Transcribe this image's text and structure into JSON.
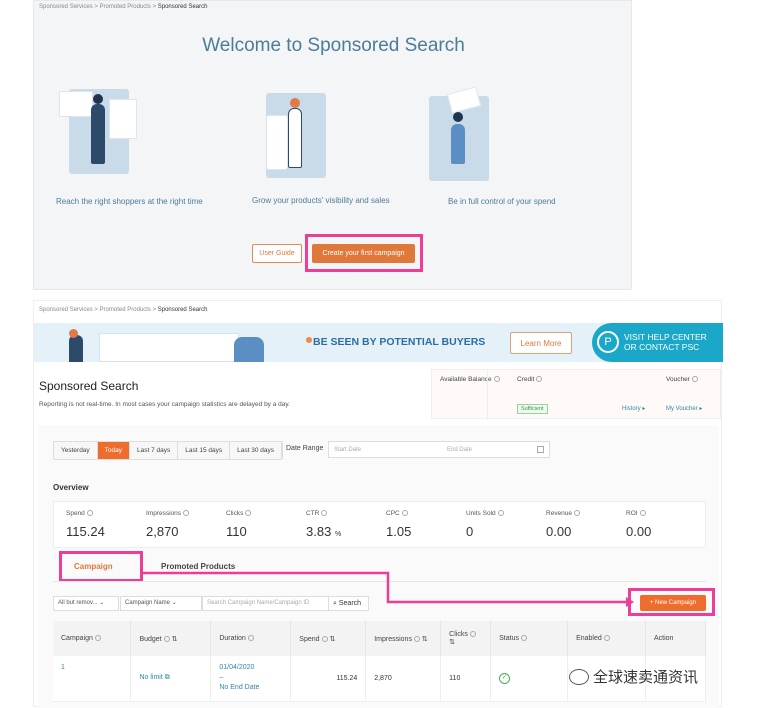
{
  "welcome": {
    "breadcrumb": [
      "Sponsored Services",
      "Promoted Products",
      "Sponsored Search"
    ],
    "title": "Welcome to Sponsored Search",
    "features": [
      "Reach the right shoppers at the right time",
      "Grow your products' visibility and sales",
      "Be in full control of your spend"
    ],
    "user_guide": "User Guide",
    "create_first": "Create your first campaign"
  },
  "page": {
    "breadcrumb": [
      "Sponsored Services",
      "Promoted Products",
      "Sponsored Search"
    ],
    "banner": {
      "headline": "BE SEEN BY POTENTIAL BUYERS",
      "learn_more": "Learn More",
      "help_line1": "VISIT HELP CENTER",
      "help_line2": "OR CONTACT PSC",
      "help_icon": "P"
    },
    "title": "Sponsored Search",
    "subtitle": "Reporting is not real-time. In most cases your campaign statistics are delayed by a day.",
    "balance": {
      "available": "Available Balance",
      "credit": "Credit",
      "voucher": "Voucher",
      "sufficient": "Sufficient",
      "history": "History ▸",
      "my_voucher": "My Voucher ▸"
    },
    "date_buttons": [
      "Yesterday",
      "Today",
      "Last 7 days",
      "Last 15 days",
      "Last 30 days"
    ],
    "date_active": "Today",
    "date_range": {
      "label": "Date Range",
      "start": "Start Date",
      "end": "End Date"
    },
    "overview": {
      "title": "Overview",
      "stats": [
        {
          "label": "Spend",
          "value": "115.24"
        },
        {
          "label": "Impressions",
          "value": "2,870"
        },
        {
          "label": "Clicks",
          "value": "110"
        },
        {
          "label": "CTR",
          "value": "3.83",
          "unit": "%"
        },
        {
          "label": "CPC",
          "value": "1.05"
        },
        {
          "label": "Units Sold",
          "value": "0"
        },
        {
          "label": "Revenue",
          "value": "0.00"
        },
        {
          "label": "ROI",
          "value": "0.00"
        }
      ]
    },
    "tabs": [
      "Campaign",
      "Promoted Products"
    ],
    "filters": {
      "status": "All but remov...",
      "field": "Campaign Name",
      "search_placeholder": "Search Campaign Name/Campaign ID",
      "search_button": "Search",
      "new_campaign": "+ New Campaign"
    },
    "table": {
      "headers": [
        "Campaign",
        "Budget",
        "Duration",
        "Spend",
        "Impressions",
        "Clicks",
        "Status",
        "Enabled",
        "Action"
      ],
      "rows": [
        {
          "campaign": "1",
          "budget": "No limit",
          "duration_start": "01/04/2020",
          "duration_sep": "–",
          "duration_end": "No End Date",
          "spend": "115.24",
          "impressions": "2,870",
          "clicks": "110",
          "status": "active"
        }
      ]
    }
  },
  "watermark": "全球速卖通资讯",
  "colors": {
    "accent": "#ee6d2d",
    "highlight": "#ee3d94",
    "link": "#2a8aa8",
    "title": "#4d7c97"
  }
}
